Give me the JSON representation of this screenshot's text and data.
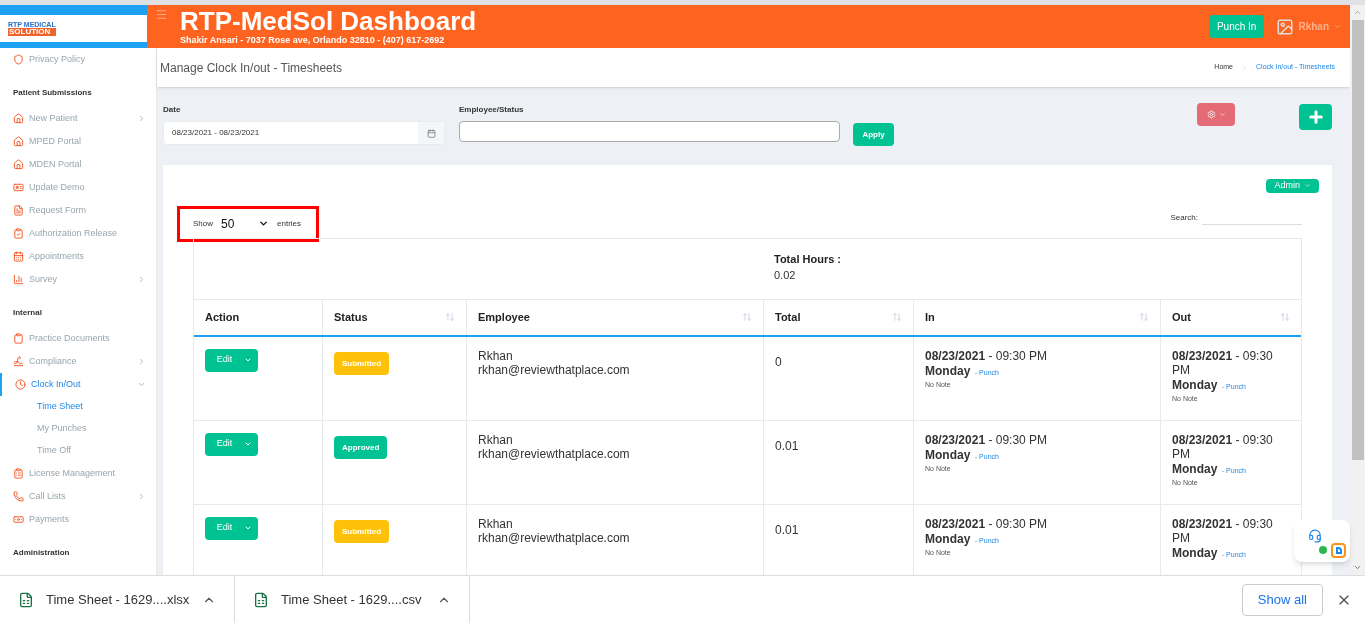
{
  "header": {
    "logo_top": "RTP MEDICAL",
    "logo_bottom": "SOLUTION",
    "title": "RTP-MedSol Dashboard",
    "subtitle": "Shakir Ansari - 7037 Rose ave, Orlando 32810 - (407) 617-2692",
    "punch_button": "Punch In",
    "user": "Rkhan"
  },
  "sidebar": [
    {
      "kind": "item",
      "label": "Privacy Policy"
    },
    {
      "kind": "heading",
      "label": "Patient Submissions"
    },
    {
      "kind": "item",
      "label": "New Patient",
      "expandable": true,
      "expanded": false
    },
    {
      "kind": "item",
      "label": "MPED Portal"
    },
    {
      "kind": "item",
      "label": "MDEN Portal"
    },
    {
      "kind": "item",
      "label": "Update Demo"
    },
    {
      "kind": "item",
      "label": "Request Form"
    },
    {
      "kind": "item",
      "label": "Authorization Release"
    },
    {
      "kind": "item",
      "label": "Appointments"
    },
    {
      "kind": "item",
      "label": "Survey",
      "expandable": true,
      "expanded": false
    },
    {
      "kind": "heading",
      "label": "Internal"
    },
    {
      "kind": "item",
      "label": "Practice Documents"
    },
    {
      "kind": "item",
      "label": "Compliance",
      "expandable": true,
      "expanded": false
    },
    {
      "kind": "item",
      "label": "Clock In/Out",
      "expandable": true,
      "expanded": true,
      "selected": true,
      "children": [
        {
          "label": "Time Sheet",
          "selected": true
        },
        {
          "label": "My Punches",
          "selected": false
        },
        {
          "label": "Time Off",
          "selected": false
        }
      ]
    },
    {
      "kind": "item",
      "label": "License Management"
    },
    {
      "kind": "item",
      "label": "Call Lists",
      "expandable": true,
      "expanded": false
    },
    {
      "kind": "item",
      "label": "Payments"
    },
    {
      "kind": "heading",
      "label": "Administration"
    }
  ],
  "page": {
    "title": "Manage Clock In/out - Timesheets",
    "breadcrumb": [
      "Home",
      "Clock In/out - Timesheets"
    ]
  },
  "filters": {
    "date_label": "Date",
    "date_value": "08/23/2021 - 08/23/2021",
    "employee_label": "Employee/Status",
    "apply": "Apply"
  },
  "card": {
    "admin": "Admin",
    "show": "Show",
    "entries_value": "50",
    "entries": "entries",
    "search": "Search:",
    "total_label": "Total Hours :",
    "total_value": "0.02"
  },
  "columns": [
    {
      "label": "Action",
      "sortable": false
    },
    {
      "label": "Status",
      "sortable": true
    },
    {
      "label": "Employee",
      "sortable": true
    },
    {
      "label": "Total",
      "sortable": true
    },
    {
      "label": "In",
      "sortable": true
    },
    {
      "label": "Out",
      "sortable": true
    }
  ],
  "rows": [
    {
      "edit": "Edit",
      "status": "Submitted",
      "color": "#fec107",
      "name": "Rkhan",
      "email": "rkhan@reviewthatplace.com",
      "total": "0",
      "in": {
        "date": "08/23/2021",
        "time": "- 09:30 PM",
        "day": "Monday",
        "type": "- Punch",
        "note": "No Note"
      },
      "out": {
        "date": "08/23/2021",
        "time": "- 09:30 PM",
        "day": "Monday",
        "type": "- Punch",
        "note": "No Note"
      }
    },
    {
      "edit": "Edit",
      "status": "Approved",
      "color": "#00c292",
      "name": "Rkhan",
      "email": "rkhan@reviewthatplace.com",
      "total": "0.01",
      "in": {
        "date": "08/23/2021",
        "time": "- 09:30 PM",
        "day": "Monday",
        "type": "- Punch",
        "note": "No Note"
      },
      "out": {
        "date": "08/23/2021",
        "time": "- 09:30 PM",
        "day": "Monday",
        "type": "- Punch",
        "note": "No Note"
      }
    },
    {
      "edit": "Edit",
      "status": "Submitted",
      "color": "#fec107",
      "name": "Rkhan",
      "email": "rkhan@reviewthatplace.com",
      "total": "0.01",
      "in": {
        "date": "08/23/2021",
        "time": "- 09:30 PM",
        "day": "Monday",
        "type": "- Punch",
        "note": "No Note"
      },
      "out": {
        "date": "08/23/2021",
        "time": "- 09:30 PM",
        "day": "Monday",
        "type": "- Punch"
      }
    }
  ],
  "downloads": [
    {
      "name": "Time Sheet - 1629....xlsx"
    },
    {
      "name": "Time Sheet - 1629....csv"
    }
  ],
  "show_all": "Show all"
}
